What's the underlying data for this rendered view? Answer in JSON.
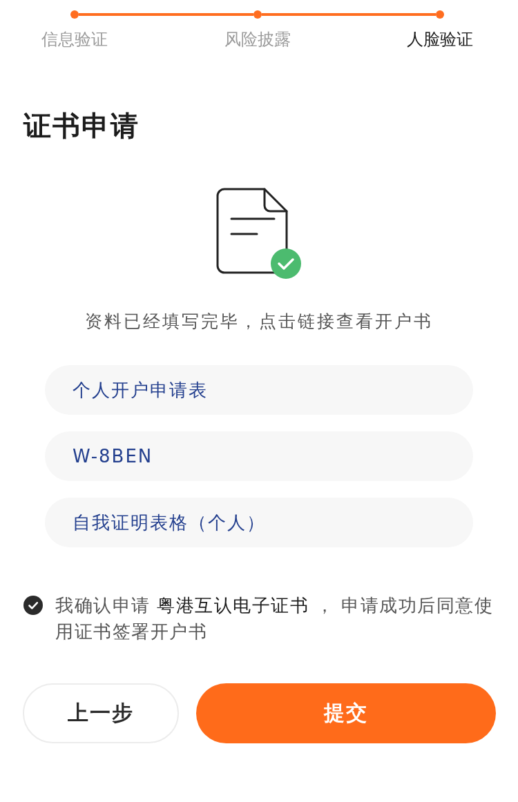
{
  "steps": [
    {
      "label": "信息验证",
      "selected": false
    },
    {
      "label": "风险披露",
      "selected": false
    },
    {
      "label": "人脸验证",
      "selected": true
    }
  ],
  "title": "证书申请",
  "message": "资料已经填写完毕，点击链接查看开户书",
  "documents": [
    "个人开户申请表",
    "W-8BEN",
    "自我证明表格（个人）"
  ],
  "agreement": {
    "checked": true,
    "text": "我确认申请 **粤港互认电子证书** ， 申请成功后同意使用证书签署开户书"
  },
  "buttons": [
    {
      "label": "上一步",
      "kind": "secondary"
    },
    {
      "label": "提交",
      "kind": "primary"
    }
  ]
}
